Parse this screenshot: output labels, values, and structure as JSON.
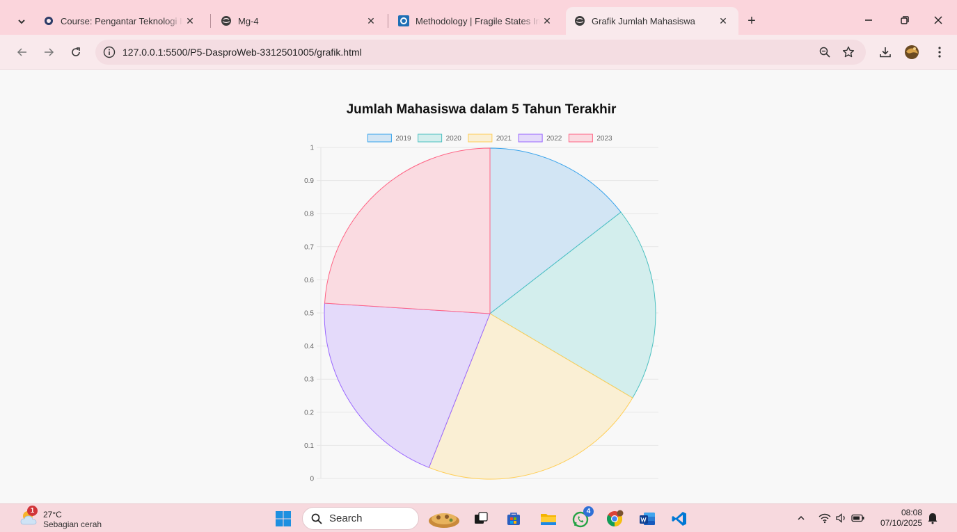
{
  "browser": {
    "tabs": [
      {
        "title": "Course: Pengantar Teknologi Inf",
        "icon": "moodle-icon",
        "active": false
      },
      {
        "title": "Mg-4",
        "icon": "globe-icon",
        "active": false
      },
      {
        "title": "Methodology | Fragile States In",
        "icon": "site-logo-icon",
        "active": false
      },
      {
        "title": "Grafik Jumlah Mahasiswa",
        "icon": "globe-icon",
        "active": true
      }
    ],
    "new_tab_label": "+",
    "url": "127.0.0.1:5500/P5-DasproWeb-3312501005/grafik.html"
  },
  "chart_data": {
    "type": "pie",
    "title": "Jumlah Mahasiswa dalam 5 Tahun Terakhir",
    "categories": [
      "2019",
      "2020",
      "2021",
      "2022",
      "2023"
    ],
    "values": [
      14.5,
      19.0,
      22.5,
      20.0,
      24.0
    ],
    "colors": {
      "border": [
        "#36a2eb",
        "#4bc0c0",
        "#ffce56",
        "#9966ff",
        "#ff6384"
      ],
      "fill": [
        "#d2e5f4",
        "#d3eeed",
        "#faefd4",
        "#e4dafa",
        "#fadbe1"
      ]
    },
    "y_ticks": [
      "0",
      "0.1",
      "0.2",
      "0.3",
      "0.4",
      "0.5",
      "0.6",
      "0.7",
      "0.8",
      "0.9",
      "1"
    ],
    "ylim": [
      0,
      1
    ],
    "legend": "top",
    "grid": true
  },
  "taskbar": {
    "weather_temp": "27°C",
    "weather_desc": "Sebagian cerah",
    "weather_badge": "1",
    "search_label": "Search",
    "whatsapp_badge": "4",
    "time": "08:08",
    "date": "07/10/2025"
  }
}
